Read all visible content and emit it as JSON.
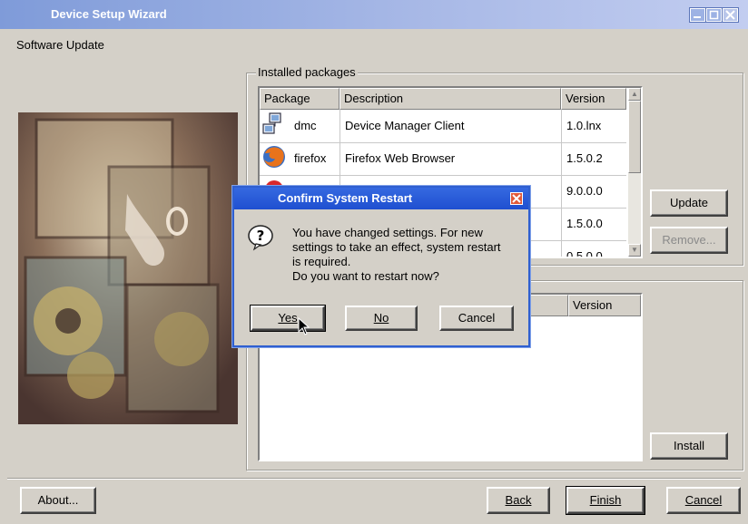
{
  "window": {
    "title": "Device Setup Wizard"
  },
  "subtitle": "Software Update",
  "installed": {
    "legend": "Installed packages",
    "columns": [
      "Package",
      "Description",
      "Version"
    ],
    "rows": [
      {
        "package": "dmc",
        "description": "Device Manager Client",
        "version": "1.0.lnx"
      },
      {
        "package": "firefox",
        "description": "Firefox Web Browser",
        "version": "1.5.0.2"
      },
      {
        "package": "",
        "description": "",
        "version": "9.0.0.0"
      },
      {
        "package": "",
        "description": "",
        "version": "1.5.0.0"
      },
      {
        "package": "",
        "description": "",
        "version": "0.5.0.0"
      }
    ],
    "update_label": "Update",
    "remove_label": "Remove..."
  },
  "available": {
    "version_header": "Version",
    "install_label": "Install"
  },
  "footer": {
    "about_label": "About...",
    "back_label": "Back",
    "finish_label": "Finish",
    "cancel_label": "Cancel"
  },
  "dialog": {
    "title": "Confirm System Restart",
    "message_lines": [
      "You have changed settings. For new",
      "settings to take an effect, system restart",
      "is required.",
      "Do you want to restart now?"
    ],
    "yes_label": "Yes",
    "no_label": "No",
    "cancel_label": "Cancel"
  },
  "colors": {
    "titlebar": "#7f9bd9",
    "dialog_titlebar": "#2554d8",
    "dialog_close": "#e15a3a",
    "face": "#d4d0c8"
  },
  "icons": [
    "device-manager-icon",
    "firefox-icon",
    "question-icon",
    "minimize-icon",
    "maximize-icon",
    "close-icon"
  ]
}
